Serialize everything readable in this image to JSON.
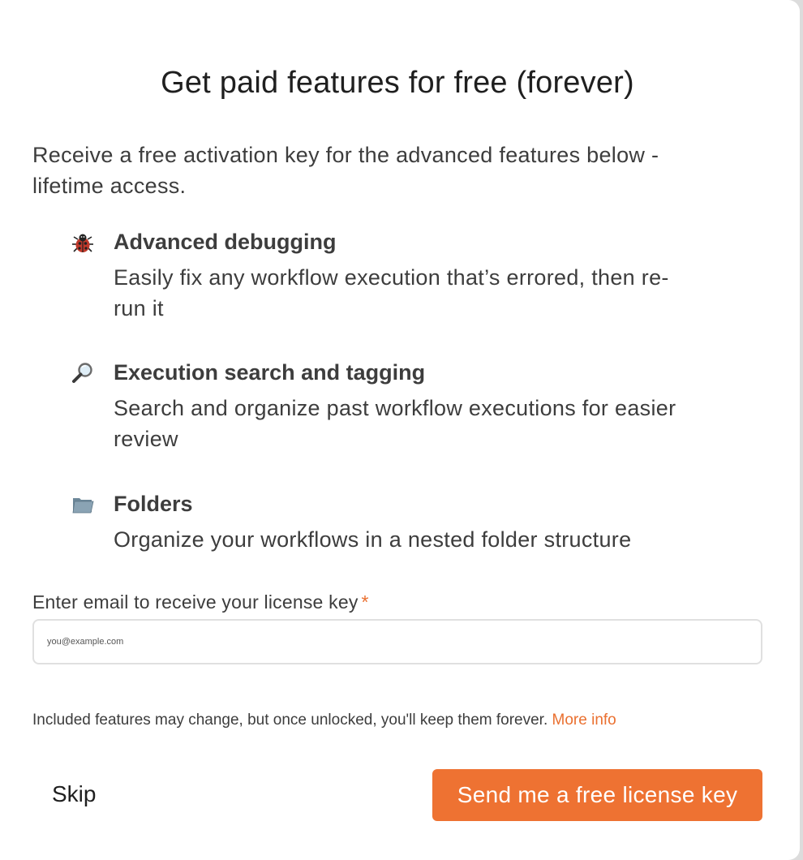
{
  "dialog": {
    "title": "Get paid features for free (forever)",
    "intro": "Receive a free activation key for the advanced features below - lifetime access."
  },
  "features": [
    {
      "icon": "ladybug-icon",
      "title": "Advanced debugging",
      "description": "Easily fix any workflow execution that’s errored, then re-run it"
    },
    {
      "icon": "magnifying-glass-icon",
      "title": "Execution search and tagging",
      "description": "Search and organize past workflow executions for easier review"
    },
    {
      "icon": "folder-icon",
      "title": "Folders",
      "description": "Organize your workflows in a nested folder structure"
    }
  ],
  "email": {
    "label": "Enter email to receive your license key",
    "required_marker": "*",
    "placeholder": "you@example.com",
    "value": ""
  },
  "note": {
    "text": "Included features may change, but once unlocked, you'll keep them forever.",
    "link": "More info"
  },
  "actions": {
    "skip_label": "Skip",
    "send_label": "Send me a free license key"
  },
  "colors": {
    "accent": "#ee7232",
    "link": "#ea7030",
    "text": "#3d3d3d"
  }
}
